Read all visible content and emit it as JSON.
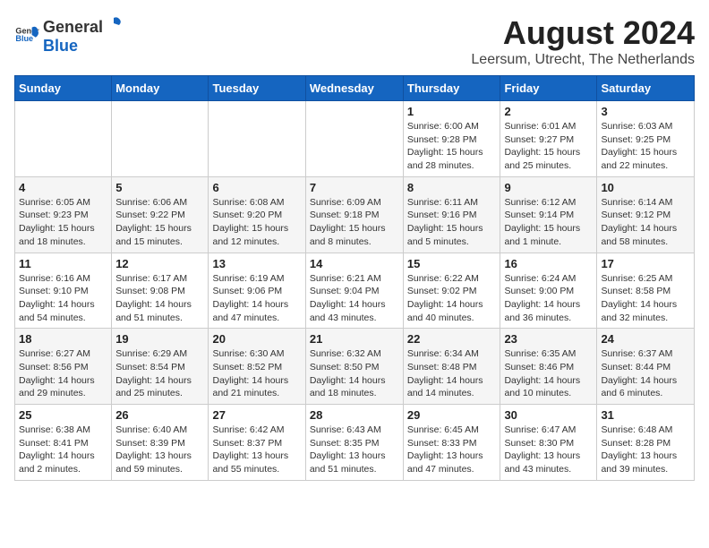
{
  "logo": {
    "text_general": "General",
    "text_blue": "Blue"
  },
  "title": "August 2024",
  "subtitle": "Leersum, Utrecht, The Netherlands",
  "days_header": [
    "Sunday",
    "Monday",
    "Tuesday",
    "Wednesday",
    "Thursday",
    "Friday",
    "Saturday"
  ],
  "weeks": [
    [
      {
        "day": "",
        "info": ""
      },
      {
        "day": "",
        "info": ""
      },
      {
        "day": "",
        "info": ""
      },
      {
        "day": "",
        "info": ""
      },
      {
        "day": "1",
        "info": "Sunrise: 6:00 AM\nSunset: 9:28 PM\nDaylight: 15 hours\nand 28 minutes."
      },
      {
        "day": "2",
        "info": "Sunrise: 6:01 AM\nSunset: 9:27 PM\nDaylight: 15 hours\nand 25 minutes."
      },
      {
        "day": "3",
        "info": "Sunrise: 6:03 AM\nSunset: 9:25 PM\nDaylight: 15 hours\nand 22 minutes."
      }
    ],
    [
      {
        "day": "4",
        "info": "Sunrise: 6:05 AM\nSunset: 9:23 PM\nDaylight: 15 hours\nand 18 minutes."
      },
      {
        "day": "5",
        "info": "Sunrise: 6:06 AM\nSunset: 9:22 PM\nDaylight: 15 hours\nand 15 minutes."
      },
      {
        "day": "6",
        "info": "Sunrise: 6:08 AM\nSunset: 9:20 PM\nDaylight: 15 hours\nand 12 minutes."
      },
      {
        "day": "7",
        "info": "Sunrise: 6:09 AM\nSunset: 9:18 PM\nDaylight: 15 hours\nand 8 minutes."
      },
      {
        "day": "8",
        "info": "Sunrise: 6:11 AM\nSunset: 9:16 PM\nDaylight: 15 hours\nand 5 minutes."
      },
      {
        "day": "9",
        "info": "Sunrise: 6:12 AM\nSunset: 9:14 PM\nDaylight: 15 hours\nand 1 minute."
      },
      {
        "day": "10",
        "info": "Sunrise: 6:14 AM\nSunset: 9:12 PM\nDaylight: 14 hours\nand 58 minutes."
      }
    ],
    [
      {
        "day": "11",
        "info": "Sunrise: 6:16 AM\nSunset: 9:10 PM\nDaylight: 14 hours\nand 54 minutes."
      },
      {
        "day": "12",
        "info": "Sunrise: 6:17 AM\nSunset: 9:08 PM\nDaylight: 14 hours\nand 51 minutes."
      },
      {
        "day": "13",
        "info": "Sunrise: 6:19 AM\nSunset: 9:06 PM\nDaylight: 14 hours\nand 47 minutes."
      },
      {
        "day": "14",
        "info": "Sunrise: 6:21 AM\nSunset: 9:04 PM\nDaylight: 14 hours\nand 43 minutes."
      },
      {
        "day": "15",
        "info": "Sunrise: 6:22 AM\nSunset: 9:02 PM\nDaylight: 14 hours\nand 40 minutes."
      },
      {
        "day": "16",
        "info": "Sunrise: 6:24 AM\nSunset: 9:00 PM\nDaylight: 14 hours\nand 36 minutes."
      },
      {
        "day": "17",
        "info": "Sunrise: 6:25 AM\nSunset: 8:58 PM\nDaylight: 14 hours\nand 32 minutes."
      }
    ],
    [
      {
        "day": "18",
        "info": "Sunrise: 6:27 AM\nSunset: 8:56 PM\nDaylight: 14 hours\nand 29 minutes."
      },
      {
        "day": "19",
        "info": "Sunrise: 6:29 AM\nSunset: 8:54 PM\nDaylight: 14 hours\nand 25 minutes."
      },
      {
        "day": "20",
        "info": "Sunrise: 6:30 AM\nSunset: 8:52 PM\nDaylight: 14 hours\nand 21 minutes."
      },
      {
        "day": "21",
        "info": "Sunrise: 6:32 AM\nSunset: 8:50 PM\nDaylight: 14 hours\nand 18 minutes."
      },
      {
        "day": "22",
        "info": "Sunrise: 6:34 AM\nSunset: 8:48 PM\nDaylight: 14 hours\nand 14 minutes."
      },
      {
        "day": "23",
        "info": "Sunrise: 6:35 AM\nSunset: 8:46 PM\nDaylight: 14 hours\nand 10 minutes."
      },
      {
        "day": "24",
        "info": "Sunrise: 6:37 AM\nSunset: 8:44 PM\nDaylight: 14 hours\nand 6 minutes."
      }
    ],
    [
      {
        "day": "25",
        "info": "Sunrise: 6:38 AM\nSunset: 8:41 PM\nDaylight: 14 hours\nand 2 minutes."
      },
      {
        "day": "26",
        "info": "Sunrise: 6:40 AM\nSunset: 8:39 PM\nDaylight: 13 hours\nand 59 minutes."
      },
      {
        "day": "27",
        "info": "Sunrise: 6:42 AM\nSunset: 8:37 PM\nDaylight: 13 hours\nand 55 minutes."
      },
      {
        "day": "28",
        "info": "Sunrise: 6:43 AM\nSunset: 8:35 PM\nDaylight: 13 hours\nand 51 minutes."
      },
      {
        "day": "29",
        "info": "Sunrise: 6:45 AM\nSunset: 8:33 PM\nDaylight: 13 hours\nand 47 minutes."
      },
      {
        "day": "30",
        "info": "Sunrise: 6:47 AM\nSunset: 8:30 PM\nDaylight: 13 hours\nand 43 minutes."
      },
      {
        "day": "31",
        "info": "Sunrise: 6:48 AM\nSunset: 8:28 PM\nDaylight: 13 hours\nand 39 minutes."
      }
    ]
  ]
}
